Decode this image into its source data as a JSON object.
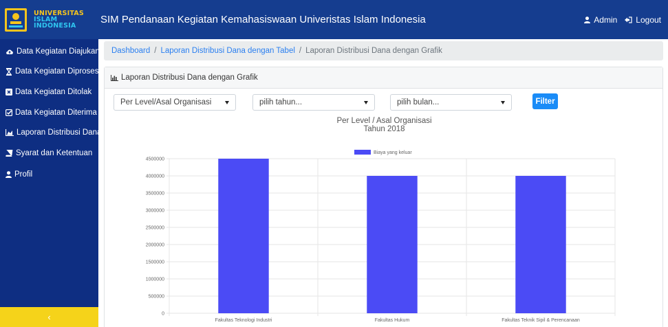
{
  "header": {
    "logo_lines": [
      "UNIVERSITAS",
      "ISLAM",
      "INDONESIA"
    ],
    "title": "SIM Pendanaan Kegiatan Kemahasiswaan Univeristas Islam Indonesia",
    "user_label": "Admin",
    "logout_label": "Logout"
  },
  "sidebar": {
    "items": [
      {
        "label": "Data Kegiatan Diajukan",
        "icon": "cloud-upload-icon"
      },
      {
        "label": "Data Kegiatan Diproses",
        "icon": "hourglass-icon"
      },
      {
        "label": "Data Kegiatan Ditolak",
        "icon": "close-box-icon"
      },
      {
        "label": "Data Kegiatan Diterima",
        "icon": "check-box-icon"
      },
      {
        "label": "Laporan Distribusi Dana",
        "icon": "area-chart-icon"
      },
      {
        "label": "Syarat dan Ketentuan",
        "icon": "book-icon"
      },
      {
        "label": "Profil",
        "icon": "user-icon"
      }
    ],
    "toggle_label": "‹"
  },
  "breadcrumb": {
    "items": [
      "Dashboard",
      "Laporan Distribusi Dana dengan Tabel",
      "Laporan Distribusi Dana dengan Grafik"
    ],
    "separator": "/"
  },
  "card": {
    "title": "Laporan Distribusi Dana dengan Grafik"
  },
  "filters": {
    "level_value": "Per Level/Asal Organisasi",
    "year_value": "pilih tahun...",
    "month_value": "pilih bulan...",
    "button_label": "Filter"
  },
  "colors": {
    "header_bg": "#153d8f",
    "sidebar_bg": "#0e2e82",
    "toggle_bg": "#f5d31a",
    "accent": "#1a8cf7",
    "bar": "#4b4bf5"
  },
  "chart_data": {
    "type": "bar",
    "title": [
      "Per Level / Asal Organisasi",
      "Tahun 2018"
    ],
    "categories": [
      "Fakultas Teknologi Industri",
      "Fakultas Hukum",
      "Fakultas Teknik Sipil & Perencanaan"
    ],
    "series": [
      {
        "name": "Biaya yang keluar",
        "values": [
          4500000,
          4000000,
          4000000
        ],
        "color": "#4b4bf5"
      }
    ],
    "yticks": [
      "4500000",
      "4000000",
      "3500000",
      "3000000",
      "2500000",
      "2000000",
      "1500000",
      "1000000",
      "500000",
      "0"
    ],
    "ylim": [
      0,
      4500000
    ],
    "grid": true,
    "legend": "top-center"
  }
}
